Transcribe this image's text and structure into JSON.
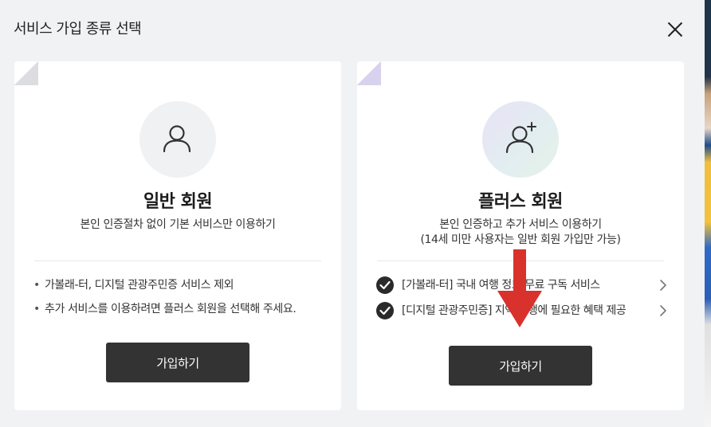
{
  "dialog": {
    "title": "서비스 가입 종류 선택"
  },
  "general": {
    "title": "일반 회원",
    "description": "본인 인증절차 없이 기본 서비스만 이용하기",
    "bullets": [
      "가볼래-터, 디지털 관광주민증 서비스 제외",
      "추가 서비스를 이용하려면 플러스 회원을 선택해 주세요."
    ],
    "button_label": "가입하기"
  },
  "plus": {
    "title": "플러스 회원",
    "description_line1": "본인 인증하고 추가 서비스 이용하기",
    "description_line2": "(14세 미만 사용자는 일반 회원 가입만 가능)",
    "benefits": [
      "[가볼래-터] 국내 여행 정보 무료 구독 서비스",
      "[디지털 관광주민증] 지역 여행에 필요한 혜택 제공"
    ],
    "button_label": "가입하기"
  },
  "colors": {
    "background": "#f1f2f4",
    "card": "#ffffff",
    "button": "#333333",
    "annotation_arrow": "#d9312b"
  },
  "icons": [
    "close-icon",
    "user-icon",
    "user-plus-icon",
    "check-circle-icon",
    "chevron-right-icon",
    "down-arrow-annotation"
  ]
}
